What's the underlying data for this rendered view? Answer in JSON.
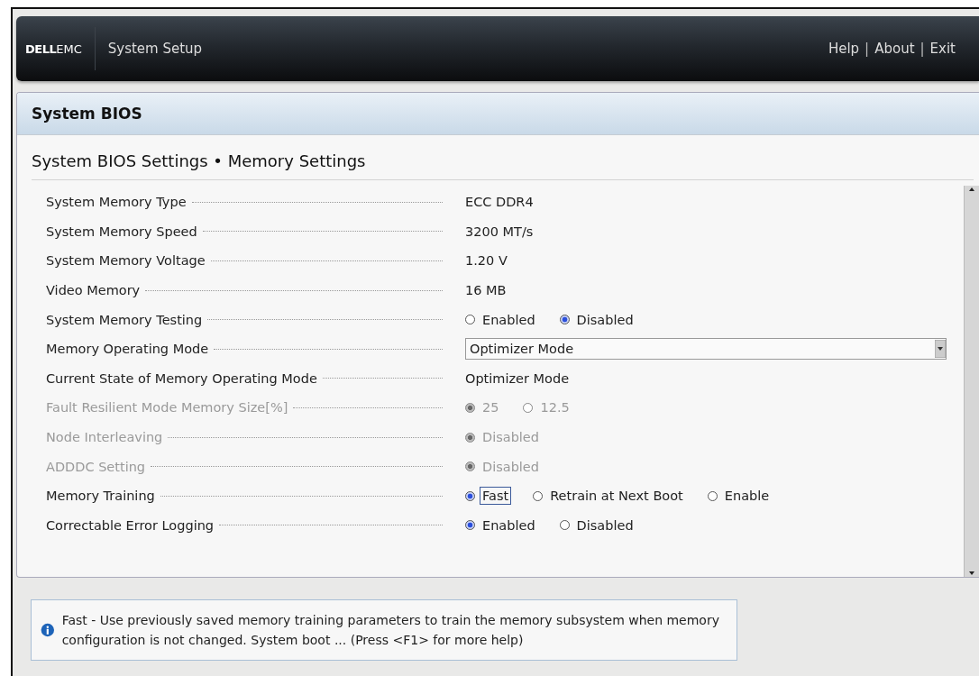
{
  "header": {
    "logo": {
      "brand": "DELL",
      "suffix": "EMC"
    },
    "title": "System Setup",
    "links": [
      "Help",
      "About",
      "Exit"
    ],
    "separator": "|"
  },
  "panel": {
    "title": "System BIOS",
    "breadcrumb": "System BIOS Settings • Memory Settings"
  },
  "settings": [
    {
      "kind": "text",
      "label": "System Memory Type",
      "disabled": false,
      "value": "ECC DDR4"
    },
    {
      "kind": "text",
      "label": "System Memory Speed",
      "disabled": false,
      "value": "3200 MT/s"
    },
    {
      "kind": "text",
      "label": "System Memory Voltage",
      "disabled": false,
      "value": "1.20 V"
    },
    {
      "kind": "text",
      "label": "Video Memory",
      "disabled": false,
      "value": "16 MB"
    },
    {
      "kind": "radio",
      "label": "System Memory Testing",
      "disabled": false,
      "options": [
        {
          "label": "Enabled",
          "selected": false,
          "focused": false
        },
        {
          "label": "Disabled",
          "selected": true,
          "focused": false
        }
      ]
    },
    {
      "kind": "dropdown",
      "label": "Memory Operating Mode",
      "disabled": false,
      "value": "Optimizer Mode"
    },
    {
      "kind": "text",
      "label": "Current State of Memory Operating Mode",
      "disabled": false,
      "value": "Optimizer Mode"
    },
    {
      "kind": "radio",
      "label": "Fault Resilient Mode Memory Size[%]",
      "disabled": true,
      "options": [
        {
          "label": "25",
          "selected": true,
          "focused": false
        },
        {
          "label": "12.5",
          "selected": false,
          "focused": false
        }
      ]
    },
    {
      "kind": "radio",
      "label": "Node Interleaving",
      "disabled": true,
      "options": [
        {
          "label": "Disabled",
          "selected": true,
          "focused": false
        }
      ]
    },
    {
      "kind": "radio",
      "label": "ADDDC Setting",
      "disabled": true,
      "options": [
        {
          "label": "Disabled",
          "selected": true,
          "focused": false
        }
      ]
    },
    {
      "kind": "radio",
      "label": "Memory Training",
      "disabled": false,
      "options": [
        {
          "label": "Fast",
          "selected": true,
          "focused": true
        },
        {
          "label": "Retrain at Next Boot",
          "selected": false,
          "focused": false
        },
        {
          "label": "Enable",
          "selected": false,
          "focused": false
        }
      ]
    },
    {
      "kind": "radio",
      "label": "Correctable Error Logging",
      "disabled": false,
      "options": [
        {
          "label": "Enabled",
          "selected": true,
          "focused": false
        },
        {
          "label": "Disabled",
          "selected": false,
          "focused": false
        }
      ]
    }
  ],
  "help": {
    "text": "Fast - Use previously saved memory training parameters to train the memory subsystem when memory configuration is not changed. System boot ... (Press <F1> for more help)"
  }
}
